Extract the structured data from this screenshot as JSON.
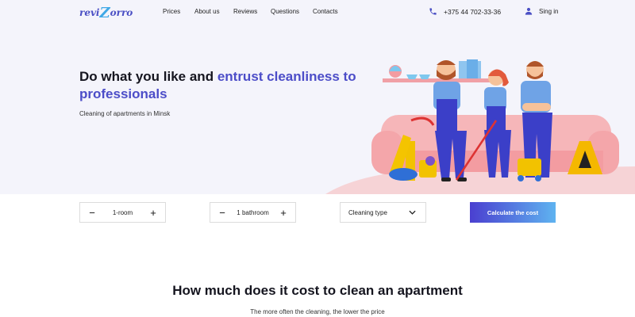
{
  "brand": {
    "logo_text_a": "revi",
    "logo_text_z": "Z",
    "logo_text_b": "orro"
  },
  "nav": {
    "items": [
      "Prices",
      "About us",
      "Reviews",
      "Questions",
      "Contacts"
    ]
  },
  "header": {
    "phone": "+375 44 702-33-36",
    "signin_label": "Sing in"
  },
  "hero": {
    "title_plain": "Do what you like and ",
    "title_accent": "entrust cleanliness to professionals",
    "subtitle": "Cleaning of apartments in Minsk"
  },
  "calculator": {
    "rooms_value": "1-room",
    "bathrooms_value": "1 bathroom",
    "minus_symbol": "−",
    "plus_symbol": "+",
    "cleaning_type_label": "Cleaning type",
    "calculate_label": "Calculate the cost"
  },
  "pricing": {
    "title": "How much does it cost to clean an apartment",
    "subtitle": "The more often the cleaning, the lower the price"
  },
  "colors": {
    "accent": "#4c4dc8",
    "button_start": "#4a3fd0",
    "button_end": "#5fb3f0",
    "hero_bg": "#f4f4fb"
  },
  "icons": {
    "phone": "phone-icon",
    "user": "user-icon",
    "chevron": "chevron-down-icon"
  }
}
